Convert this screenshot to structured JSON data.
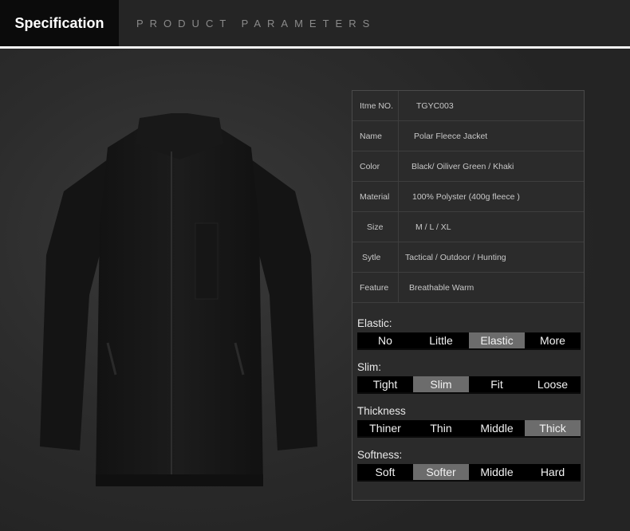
{
  "header": {
    "title": "Specification",
    "subtitle": "PRODUCT PARAMETERS"
  },
  "specs": [
    {
      "label": "Itme NO.",
      "value": "TGYC003"
    },
    {
      "label": "Name",
      "value": "Polar Fleece Jacket"
    },
    {
      "label": "Color",
      "value": "Black/ Oiliver Green / Khaki"
    },
    {
      "label": "Material",
      "value": "100% Polyster (400g fleece )"
    },
    {
      "label": "Size",
      "value": "M / L / XL"
    },
    {
      "label": "Sytle",
      "value": "Tactical / Outdoor / Hunting"
    },
    {
      "label": "Feature",
      "value": "Breathable Warm"
    }
  ],
  "scales": [
    {
      "title": "Elastic:",
      "options": [
        "No",
        "Little",
        "Elastic",
        "More"
      ],
      "selected": "Elastic"
    },
    {
      "title": "Slim:",
      "options": [
        "Tight",
        "Slim",
        "Fit",
        "Loose"
      ],
      "selected": "Slim"
    },
    {
      "title": "Thickness",
      "options": [
        "Thiner",
        "Thin",
        "Middle",
        "Thick"
      ],
      "selected": "Thick"
    },
    {
      "title": "Softness:",
      "options": [
        "Soft",
        "Softer",
        "Middle",
        "Hard"
      ],
      "selected": "Softer"
    }
  ],
  "colors": {
    "header_box": "#0b0b0b",
    "selected_option": "#6c6c6c",
    "option_bar": "#000000"
  }
}
